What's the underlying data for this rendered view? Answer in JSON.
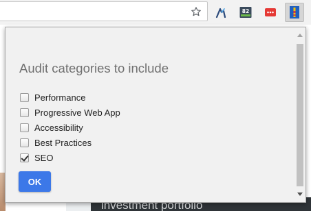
{
  "toolbar": {
    "star_icon": "bookmark-star-icon",
    "extensions": [
      {
        "name": "arrow-extension-icon",
        "color": "#2b4a7a"
      },
      {
        "name": "metric-extension-icon",
        "badge": "82",
        "color": "#3a4a5c"
      },
      {
        "name": "red-dots-extension-icon",
        "color": "#e53935"
      },
      {
        "name": "lighthouse-extension-icon",
        "color": "#1f5fbf"
      }
    ]
  },
  "page_behind": {
    "heading_fragment": "investment portfolio"
  },
  "popup": {
    "title": "Audit categories to include",
    "categories": [
      {
        "label": "Performance",
        "checked": false
      },
      {
        "label": "Progressive Web App",
        "checked": false
      },
      {
        "label": "Accessibility",
        "checked": false
      },
      {
        "label": "Best Practices",
        "checked": false
      },
      {
        "label": "SEO",
        "checked": true
      }
    ],
    "ok_label": "OK",
    "accent_color": "#3c78e8"
  }
}
